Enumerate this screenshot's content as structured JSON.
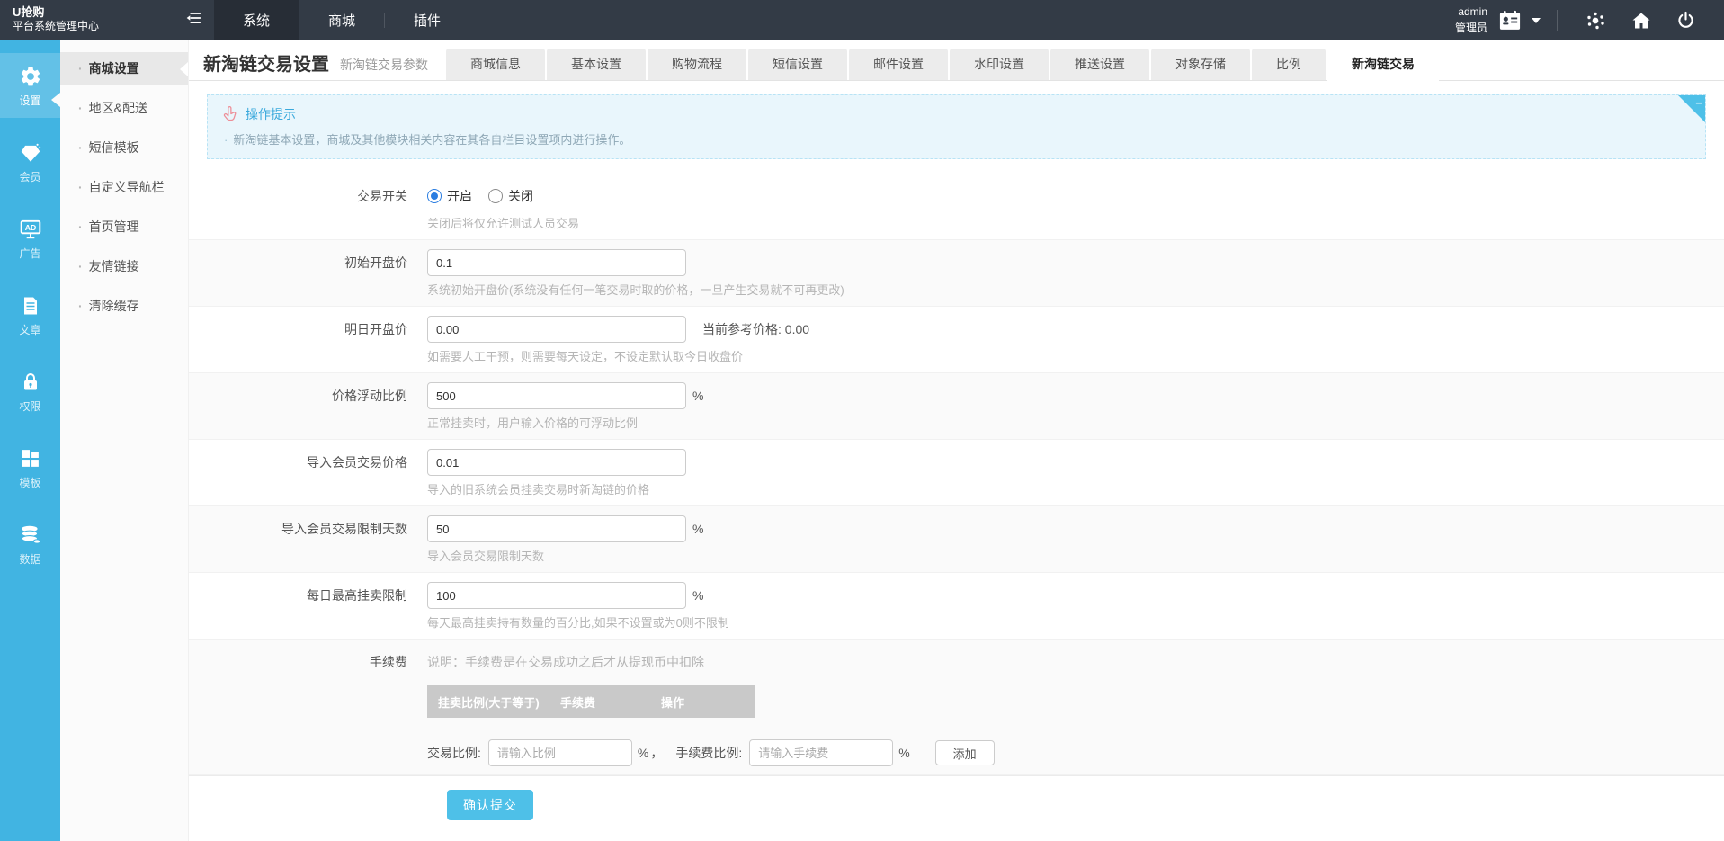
{
  "topbar": {
    "logo_line1": "U抢购",
    "logo_line2": "平台系统管理中心",
    "nav": [
      {
        "label": "系统",
        "active": true
      },
      {
        "label": "商城",
        "active": false
      },
      {
        "label": "插件",
        "active": false
      }
    ],
    "user": {
      "name": "admin",
      "role": "管理员"
    }
  },
  "sidebar": {
    "items": [
      {
        "label": "设置",
        "icon": "gear",
        "active": true
      },
      {
        "label": "会员",
        "icon": "gem",
        "active": false
      },
      {
        "label": "广告",
        "icon": "ad-board",
        "active": false
      },
      {
        "label": "文章",
        "icon": "article",
        "active": false
      },
      {
        "label": "权限",
        "icon": "lock",
        "active": false
      },
      {
        "label": "模板",
        "icon": "template-grid",
        "active": false
      },
      {
        "label": "数据",
        "icon": "database",
        "active": false
      }
    ]
  },
  "submenu": {
    "bullet": "·",
    "items": [
      {
        "label": "商城设置",
        "active": true
      },
      {
        "label": "地区&配送",
        "active": false
      },
      {
        "label": "短信模板",
        "active": false
      },
      {
        "label": "自定义导航栏",
        "active": false
      },
      {
        "label": "首页管理",
        "active": false
      },
      {
        "label": "友情链接",
        "active": false
      },
      {
        "label": "清除缓存",
        "active": false
      }
    ]
  },
  "page": {
    "title": "新淘链交易设置",
    "subtitle": "新淘链交易参数"
  },
  "tabs": [
    {
      "label": "商城信息",
      "active": false
    },
    {
      "label": "基本设置",
      "active": false
    },
    {
      "label": "购物流程",
      "active": false
    },
    {
      "label": "短信设置",
      "active": false
    },
    {
      "label": "邮件设置",
      "active": false
    },
    {
      "label": "水印设置",
      "active": false
    },
    {
      "label": "推送设置",
      "active": false
    },
    {
      "label": "对象存储",
      "active": false
    },
    {
      "label": "比例",
      "active": false
    },
    {
      "label": "新淘链交易",
      "active": true
    }
  ],
  "notice": {
    "title": "操作提示",
    "bullet": "·",
    "message": "新淘链基本设置，商城及其他模块相关内容在其各自栏目设置项内进行操作。",
    "collapse_glyph": "−"
  },
  "form": {
    "trade_switch": {
      "label": "交易开关",
      "option_on": "开启",
      "option_off": "关闭",
      "selected": "开启",
      "hint": "关闭后将仅允许测试人员交易"
    },
    "initial_price": {
      "label": "初始开盘价",
      "value": "0.1",
      "hint": "系统初始开盘价(系统没有任何一笔交易时取的价格，一旦产生交易就不可再更改)"
    },
    "tomorrow_price": {
      "label": "明日开盘价",
      "value": "0.00",
      "reference": "当前参考价格: 0.00",
      "hint": "如需要人工干预，则需要每天设定，不设定默认取今日收盘价"
    },
    "float_ratio": {
      "label": "价格浮动比例",
      "value": "500",
      "suffix": "%",
      "hint": "正常挂卖时，用户输入价格的可浮动比例"
    },
    "import_price": {
      "label": "导入会员交易价格",
      "value": "0.01",
      "hint": "导入的旧系统会员挂卖交易时新淘链的价格"
    },
    "import_limit_days": {
      "label": "导入会员交易限制天数",
      "value": "50",
      "suffix": "%",
      "hint": "导入会员交易限制天数"
    },
    "daily_max_ratio": {
      "label": "每日最高挂卖限制",
      "value": "100",
      "suffix": "%",
      "hint": "每天最高挂卖持有数量的百分比,如果不设置或为0则不限制"
    },
    "fee": {
      "label": "手续费",
      "note": "说明：手续费是在交易成功之后才从提现币中扣除",
      "columns": [
        "挂卖比例(大于等于)",
        "手续费",
        "操作"
      ],
      "ratio_label": "交易比例:",
      "ratio_placeholder": "请输入比例",
      "percent": "%",
      "comma": "，",
      "fee_label": "手续费比例:",
      "fee_placeholder": "请输入手续费",
      "add_label": "添加"
    },
    "submit_label": "确认提交"
  },
  "colors": {
    "topbar_bg": "#333b46",
    "topnav_active_bg": "#272d36",
    "sidebar_bg": "#41b4e2",
    "accent": "#4ec0e8",
    "notice_bg": "#e9f6fc",
    "notice_title": "#3aa9dc",
    "table_header_bg": "#c9c9c9",
    "radio_checked": "#2a7de1",
    "stripe_bg": "#fafafa"
  }
}
